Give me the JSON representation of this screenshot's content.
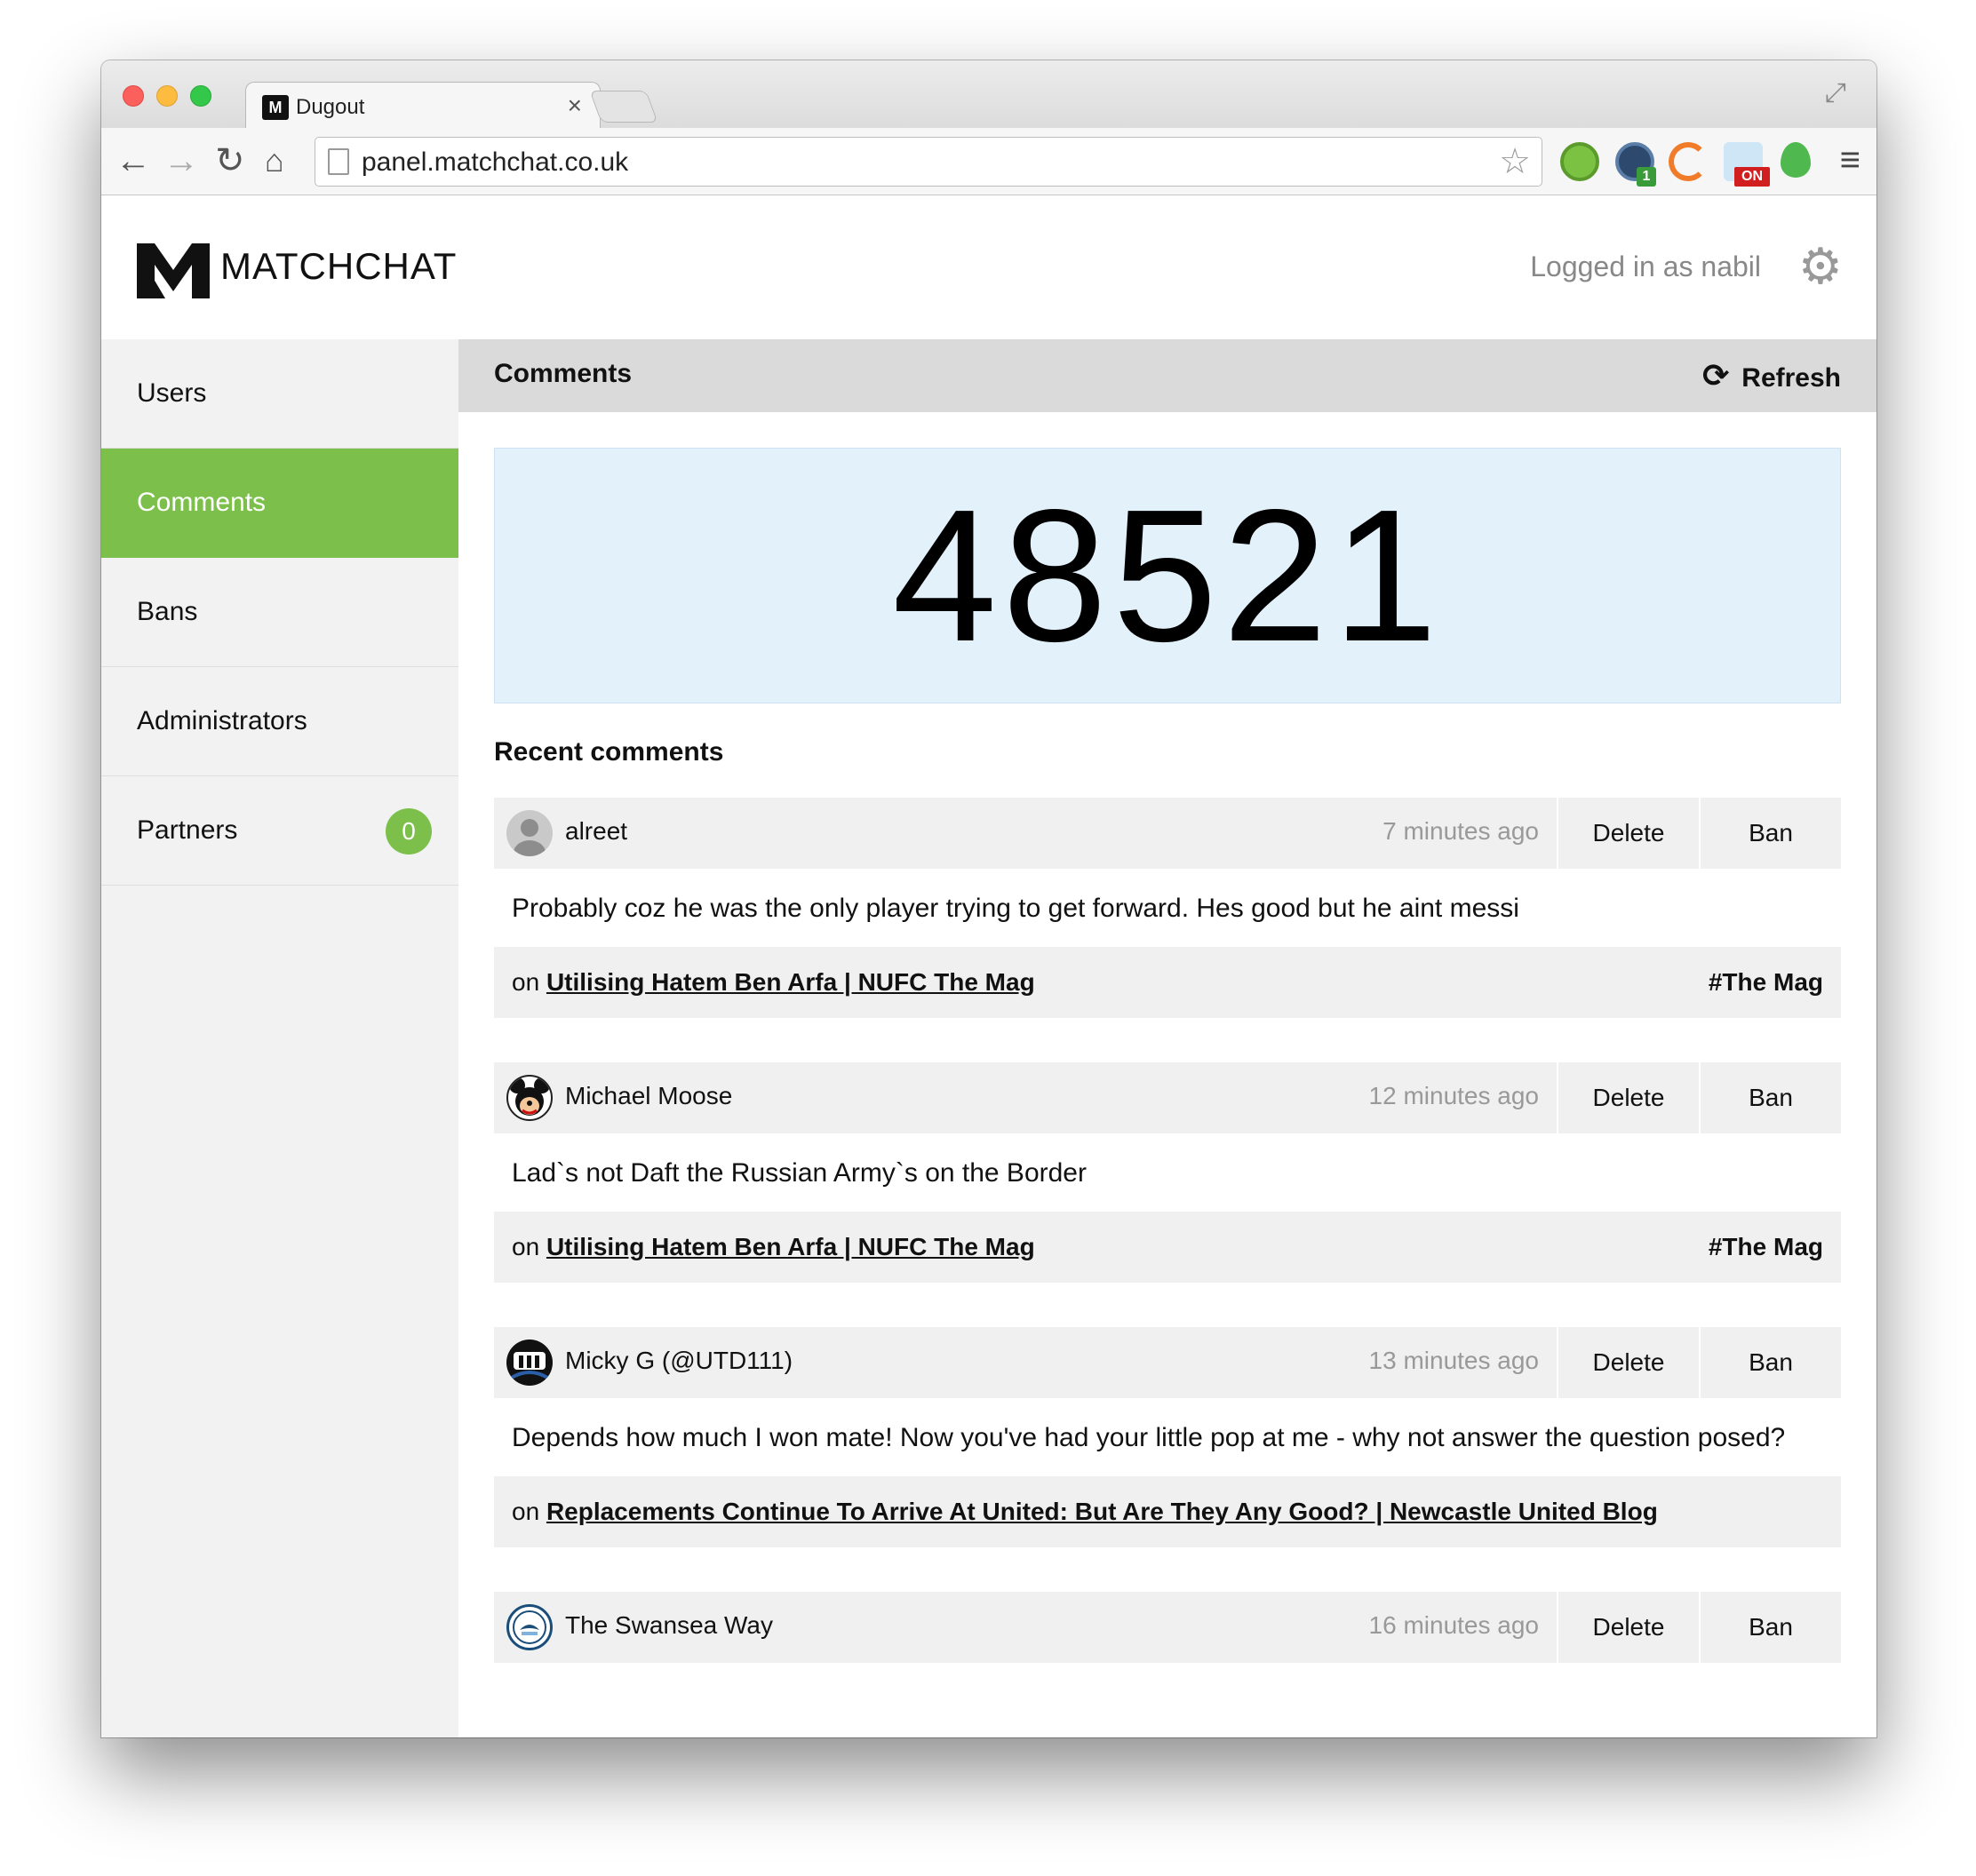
{
  "browser": {
    "tab_title": "Dugout",
    "tab_close": "×",
    "url": "panel.matchchat.co.uk",
    "ext_badge_1": "1",
    "ext_badge_on": "ON"
  },
  "app": {
    "brand": "MATCHCHAT",
    "logged_in": "Logged in as nabil",
    "accent_color": "#7cc04b"
  },
  "sidebar": {
    "items": [
      {
        "label": "Users"
      },
      {
        "label": "Comments",
        "active": true
      },
      {
        "label": "Bans"
      },
      {
        "label": "Administrators"
      },
      {
        "label": "Partners",
        "badge": "0"
      }
    ]
  },
  "main": {
    "title": "Comments",
    "refresh_label": "Refresh",
    "total_count": "48521",
    "recent_title": "Recent comments"
  },
  "comments": [
    {
      "user": "alreet",
      "time": "7 minutes ago",
      "delete_label": "Delete",
      "ban_label": "Ban",
      "text": "Probably coz he was the only player trying to get forward. Hes good but he aint messi",
      "on_label": "on",
      "article": "Utilising Hatem Ben Arfa | NUFC The Mag",
      "tag": "#The Mag"
    },
    {
      "user": "Michael Moose",
      "time": "12 minutes ago",
      "delete_label": "Delete",
      "ban_label": "Ban",
      "text": "Lad`s not Daft the Russian Army`s on the Border",
      "on_label": "on",
      "article": "Utilising Hatem Ben Arfa | NUFC The Mag",
      "tag": "#The Mag"
    },
    {
      "user": "Micky G (@UTD111)",
      "time": "13 minutes ago",
      "delete_label": "Delete",
      "ban_label": "Ban",
      "text": "Depends how much I won mate! Now you've had your little pop at me - why not answer the question posed?",
      "on_label": "on",
      "article": "Replacements Continue To Arrive At United: But Are They Any Good? | Newcastle United Blog",
      "tag": ""
    },
    {
      "user": "The Swansea Way",
      "time": "16 minutes ago",
      "delete_label": "Delete",
      "ban_label": "Ban"
    }
  ]
}
